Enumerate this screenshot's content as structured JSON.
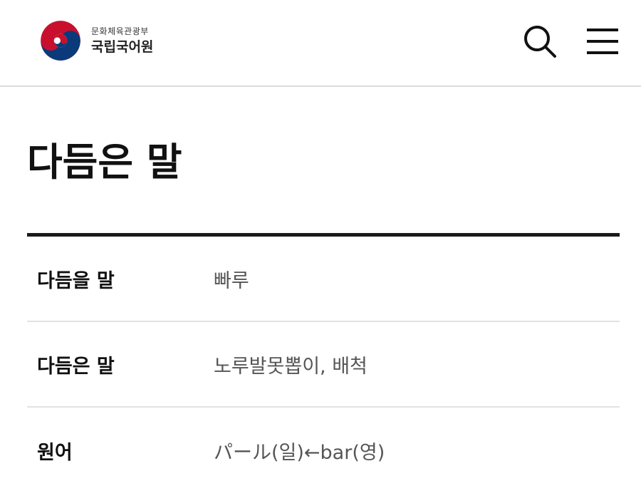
{
  "header": {
    "ministry": "문화체육관광부",
    "org_name": "국립국어원",
    "logo_icon": "taegeuk-logo-icon",
    "search_icon": "search-icon",
    "menu_icon": "hamburger-menu-icon"
  },
  "page": {
    "title": "다듬은 말"
  },
  "rows": [
    {
      "label": "다듬을 말",
      "value": "빠루"
    },
    {
      "label": "다듬은 말",
      "value": "노루발못뽑이, 배척"
    },
    {
      "label": "원어",
      "value": "パール(일)←bar(영)"
    }
  ],
  "colors": {
    "logo_red": "#c8102e",
    "logo_blue": "#0a3a7a",
    "divider_dark": "#1a1a1a",
    "divider_light": "#e2e2e2"
  }
}
